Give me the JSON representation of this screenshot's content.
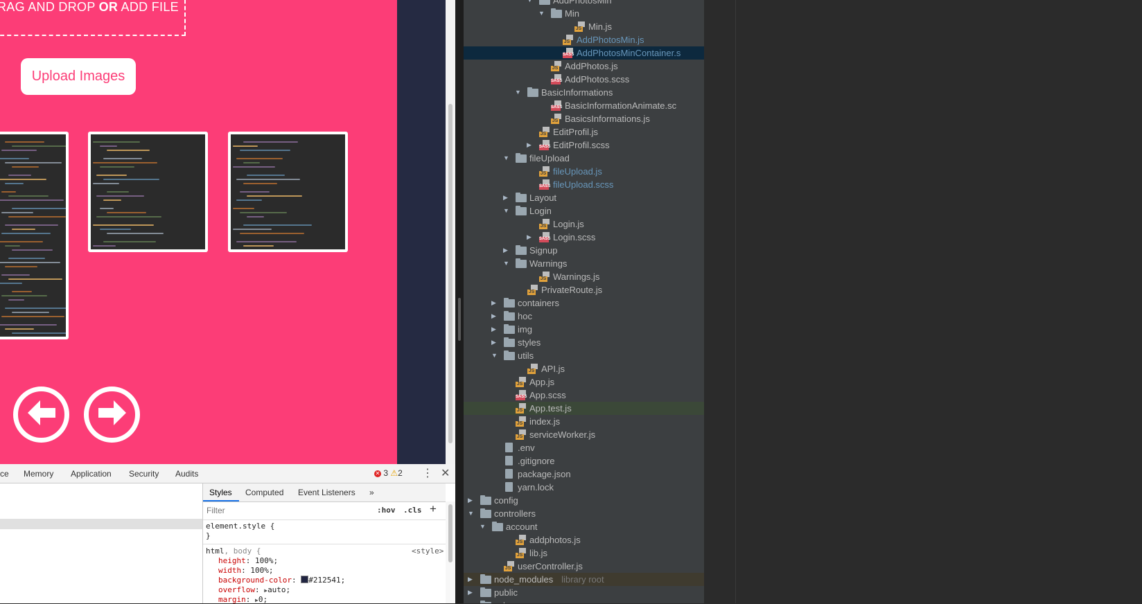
{
  "app": {
    "drop_prefix": "RAG AND DROP ",
    "drop_bold": "OR",
    "drop_suffix": " ADD FILE",
    "upload_button": "Upload Images",
    "prev_icon": "arrow-left-circle-icon",
    "next_icon": "arrow-right-circle-icon",
    "accent_color": "#fc3d77",
    "dark_panel_color": "#252a42"
  },
  "devtools": {
    "tabs": [
      "ce",
      "Memory",
      "Application",
      "Security",
      "Audits"
    ],
    "error_count": "3",
    "warning_count": "2",
    "styles_tabs": [
      "Styles",
      "Computed",
      "Event Listeners",
      "»"
    ],
    "filter_placeholder": "Filter",
    "hov": ":hov",
    "cls": ".cls",
    "add": "+",
    "element_style": "element.style {",
    "close_brace": "}",
    "selector_html": "html",
    "selector_rest": ", body {",
    "source": "<style>",
    "props": [
      {
        "name": "height",
        "value": "100%;"
      },
      {
        "name": "width",
        "value": "100%;"
      },
      {
        "name": "background-color",
        "value": "#212541;"
      },
      {
        "name": "overflow",
        "value": "auto;"
      },
      {
        "name": "margin",
        "value": "0;"
      }
    ]
  },
  "tree": {
    "items": [
      {
        "label": "AddPhotosMin",
        "depth": 6,
        "type": "folder",
        "open": true
      },
      {
        "label": "Min",
        "depth": 7,
        "type": "folder",
        "open": true
      },
      {
        "label": "Min.js",
        "depth": 9,
        "type": "js"
      },
      {
        "label": "AddPhotosMin.js",
        "depth": 8,
        "type": "js",
        "color": "blue"
      },
      {
        "label": "AddPhotosMinContainer.s",
        "depth": 8,
        "type": "sass",
        "color": "blue",
        "selected": true
      },
      {
        "label": "AddPhotos.js",
        "depth": 7,
        "type": "js"
      },
      {
        "label": "AddPhotos.scss",
        "depth": 7,
        "type": "sass"
      },
      {
        "label": "BasicInformations",
        "depth": 5,
        "type": "folder",
        "open": true
      },
      {
        "label": "BasicInformationAnimate.sc",
        "depth": 7,
        "type": "sass"
      },
      {
        "label": "BasicsInformations.js",
        "depth": 7,
        "type": "js"
      },
      {
        "label": "EditProfil.js",
        "depth": 6,
        "type": "js"
      },
      {
        "label": "EditProfil.scss",
        "depth": 6,
        "type": "sass",
        "collapsed_arrow": true
      },
      {
        "label": "fileUpload",
        "depth": 4,
        "type": "folder",
        "open": true
      },
      {
        "label": "fileUpload.js",
        "depth": 6,
        "type": "js",
        "color": "blue"
      },
      {
        "label": "fileUpload.scss",
        "depth": 6,
        "type": "sass",
        "color": "blue"
      },
      {
        "label": "Layout",
        "depth": 4,
        "type": "folder",
        "open": false
      },
      {
        "label": "Login",
        "depth": 4,
        "type": "folder",
        "open": true
      },
      {
        "label": "Login.js",
        "depth": 6,
        "type": "js"
      },
      {
        "label": "Login.scss",
        "depth": 6,
        "type": "sass",
        "collapsed_arrow": true
      },
      {
        "label": "Signup",
        "depth": 4,
        "type": "folder",
        "open": false
      },
      {
        "label": "Warnings",
        "depth": 4,
        "type": "folder",
        "open": true
      },
      {
        "label": "Warnings.js",
        "depth": 6,
        "type": "js"
      },
      {
        "label": "PrivateRoute.js",
        "depth": 5,
        "type": "js"
      },
      {
        "label": "containers",
        "depth": 3,
        "type": "folder",
        "open": false
      },
      {
        "label": "hoc",
        "depth": 3,
        "type": "folder",
        "open": false
      },
      {
        "label": "img",
        "depth": 3,
        "type": "folder",
        "open": false
      },
      {
        "label": "styles",
        "depth": 3,
        "type": "folder",
        "open": false
      },
      {
        "label": "utils",
        "depth": 3,
        "type": "folder",
        "open": true
      },
      {
        "label": "API.js",
        "depth": 5,
        "type": "js"
      },
      {
        "label": "App.js",
        "depth": 4,
        "type": "js"
      },
      {
        "label": "App.scss",
        "depth": 4,
        "type": "sass"
      },
      {
        "label": "App.test.js",
        "depth": 4,
        "type": "js",
        "highlight": true
      },
      {
        "label": "index.js",
        "depth": 4,
        "type": "js"
      },
      {
        "label": "serviceWorker.js",
        "depth": 4,
        "type": "js"
      },
      {
        "label": ".env",
        "depth": 3,
        "type": "file"
      },
      {
        "label": ".gitignore",
        "depth": 3,
        "type": "file"
      },
      {
        "label": "package.json",
        "depth": 3,
        "type": "file"
      },
      {
        "label": "yarn.lock",
        "depth": 3,
        "type": "file"
      },
      {
        "label": "config",
        "depth": 1,
        "type": "folder",
        "open": false
      },
      {
        "label": "controllers",
        "depth": 1,
        "type": "folder",
        "open": true
      },
      {
        "label": "account",
        "depth": 2,
        "type": "folder",
        "open": true
      },
      {
        "label": "addphotos.js",
        "depth": 4,
        "type": "js"
      },
      {
        "label": "lib.js",
        "depth": 4,
        "type": "js"
      },
      {
        "label": "userController.js",
        "depth": 3,
        "type": "js"
      },
      {
        "label": "node_modules",
        "depth": 1,
        "type": "folder",
        "open": false,
        "suffix": "library root",
        "excluded": true
      },
      {
        "label": "public",
        "depth": 1,
        "type": "folder",
        "open": false
      },
      {
        "label": "schema",
        "depth": 1,
        "type": "folder",
        "open": true
      }
    ]
  }
}
